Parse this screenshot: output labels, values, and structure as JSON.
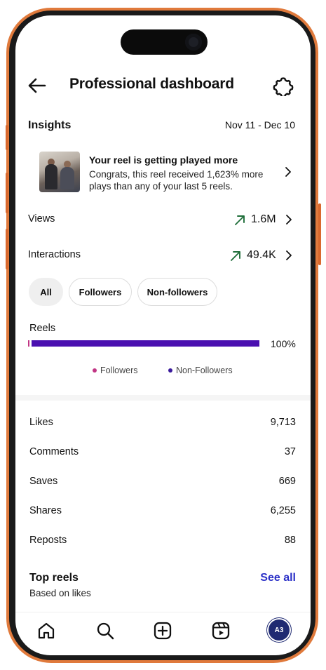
{
  "header": {
    "title": "Professional dashboard"
  },
  "insights": {
    "label": "Insights",
    "date_range": "Nov 11 - Dec 10",
    "reel_card": {
      "title": "Your reel is getting played more",
      "description": "Congrats, this reel received 1,623% more plays than any of your last 5 reels."
    },
    "views": {
      "label": "Views",
      "value": "1.6M"
    },
    "interactions": {
      "label": "Interactions",
      "value": "49.4K"
    }
  },
  "filters": [
    "All",
    "Followers",
    "Non-followers"
  ],
  "reels_chart": {
    "label": "Reels",
    "percent_text": "100%",
    "followers_fraction": 0.0,
    "non_followers_fraction": 1.0,
    "legend": [
      "Followers",
      "Non-Followers"
    ]
  },
  "colors": {
    "followers": "#c13584",
    "non_followers": "#4a0fb0",
    "link": "#2b30c7",
    "trend": "#1f6e3a"
  },
  "stats": [
    {
      "label": "Likes",
      "value": "9,713"
    },
    {
      "label": "Comments",
      "value": "37"
    },
    {
      "label": "Saves",
      "value": "669"
    },
    {
      "label": "Shares",
      "value": "6,255"
    },
    {
      "label": "Reposts",
      "value": "88"
    }
  ],
  "top_reels": {
    "title": "Top reels",
    "subtitle": "Based on likes",
    "see_all": "See all"
  },
  "nav": {
    "icons": [
      "home-icon",
      "search-icon",
      "create-icon",
      "reels-icon",
      "profile-avatar"
    ],
    "avatar_text": "A3"
  }
}
